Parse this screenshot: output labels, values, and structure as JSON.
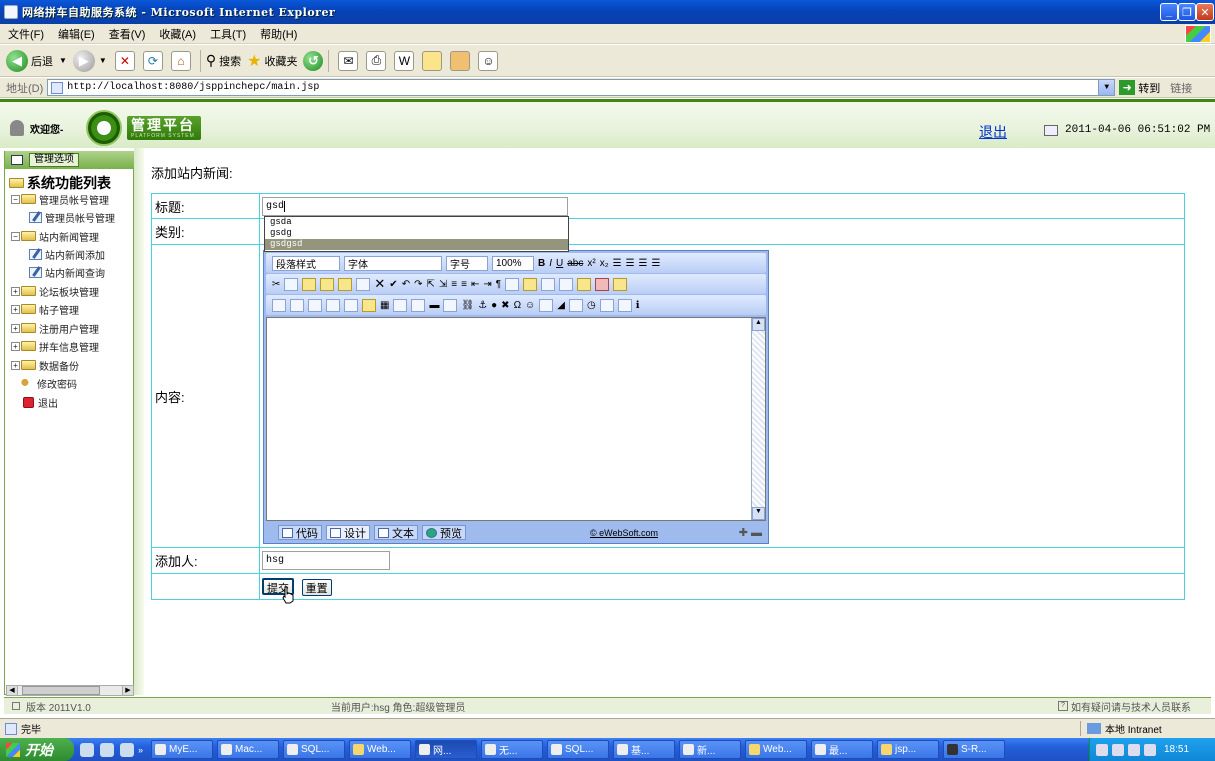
{
  "window": {
    "title": "网络拼车自助服务系统 - Microsoft Internet Explorer"
  },
  "menu": [
    "文件(F)",
    "编辑(E)",
    "查看(V)",
    "收藏(A)",
    "工具(T)",
    "帮助(H)"
  ],
  "toolbar": {
    "back": "后退",
    "search": "搜索",
    "favorites": "收藏夹"
  },
  "address": {
    "label": "地址(D)",
    "url": "http://localhost:8080/jsppinchepc/main.jsp",
    "go": "转到",
    "links": "链接"
  },
  "header": {
    "welcome": "欢迎您-",
    "logo_text": "管理平台",
    "logo_sub": "PLATFORM SYSTEM",
    "logout": "退出",
    "datetime": "2011-04-06 06:51:02 PM"
  },
  "sidebar": {
    "option_button": "管理选项",
    "tree_title": "系统功能列表",
    "items": [
      {
        "label": "管理员帐号管理",
        "type": "folder",
        "level": 0
      },
      {
        "label": "管理员帐号管理",
        "type": "page",
        "level": 1
      },
      {
        "label": "站内新闻管理",
        "type": "folder",
        "level": 0
      },
      {
        "label": "站内新闻添加",
        "type": "page",
        "level": 1
      },
      {
        "label": "站内新闻查询",
        "type": "page",
        "level": 1
      },
      {
        "label": "论坛板块管理",
        "type": "folder",
        "level": 0
      },
      {
        "label": "帖子管理",
        "type": "folder",
        "level": 0
      },
      {
        "label": "注册用户管理",
        "type": "folder",
        "level": 0
      },
      {
        "label": "拼车信息管理",
        "type": "folder",
        "level": 0
      },
      {
        "label": "数据备份",
        "type": "folder",
        "level": 0
      },
      {
        "label": "修改密码",
        "type": "key",
        "level": 0
      },
      {
        "label": "退出",
        "type": "exit",
        "level": 0
      }
    ]
  },
  "main": {
    "page_title": "添加站内新闻:",
    "fields": {
      "title_label": "标题:",
      "title_value": "gsd",
      "category_label": "类别:",
      "content_label": "内容:",
      "author_label": "添加人:",
      "author_value": "hsg"
    },
    "autocomplete": [
      "gsda",
      "gsdg",
      "gsdgsd"
    ],
    "autocomplete_selected": 2,
    "editor": {
      "format_combo": "段落样式",
      "font_combo": "字体",
      "size_combo": "字号",
      "zoom_combo": "100%",
      "tabs": [
        "代码",
        "设计",
        "文本",
        "预览"
      ],
      "copyright": "© eWebSoft.com"
    },
    "buttons": {
      "submit": "提交",
      "reset": "重置"
    }
  },
  "statusstrip": {
    "version": "版本 2011V1.0",
    "current_user": "当前用户:hsg  角色:超级管理员",
    "contact": "如有疑问请与技术人员联系"
  },
  "iestatus": {
    "done": "完毕",
    "zone": "本地 Intranet"
  },
  "taskbar": {
    "start": "开始",
    "tasks": [
      "MyE...",
      "Mac...",
      "SQL...",
      "Web...",
      "网...",
      "无...",
      "SQL...",
      "基...",
      "新...",
      "Web...",
      "最...",
      "jsp...",
      "S-R..."
    ],
    "active_index": 4,
    "clock": "18:51"
  }
}
